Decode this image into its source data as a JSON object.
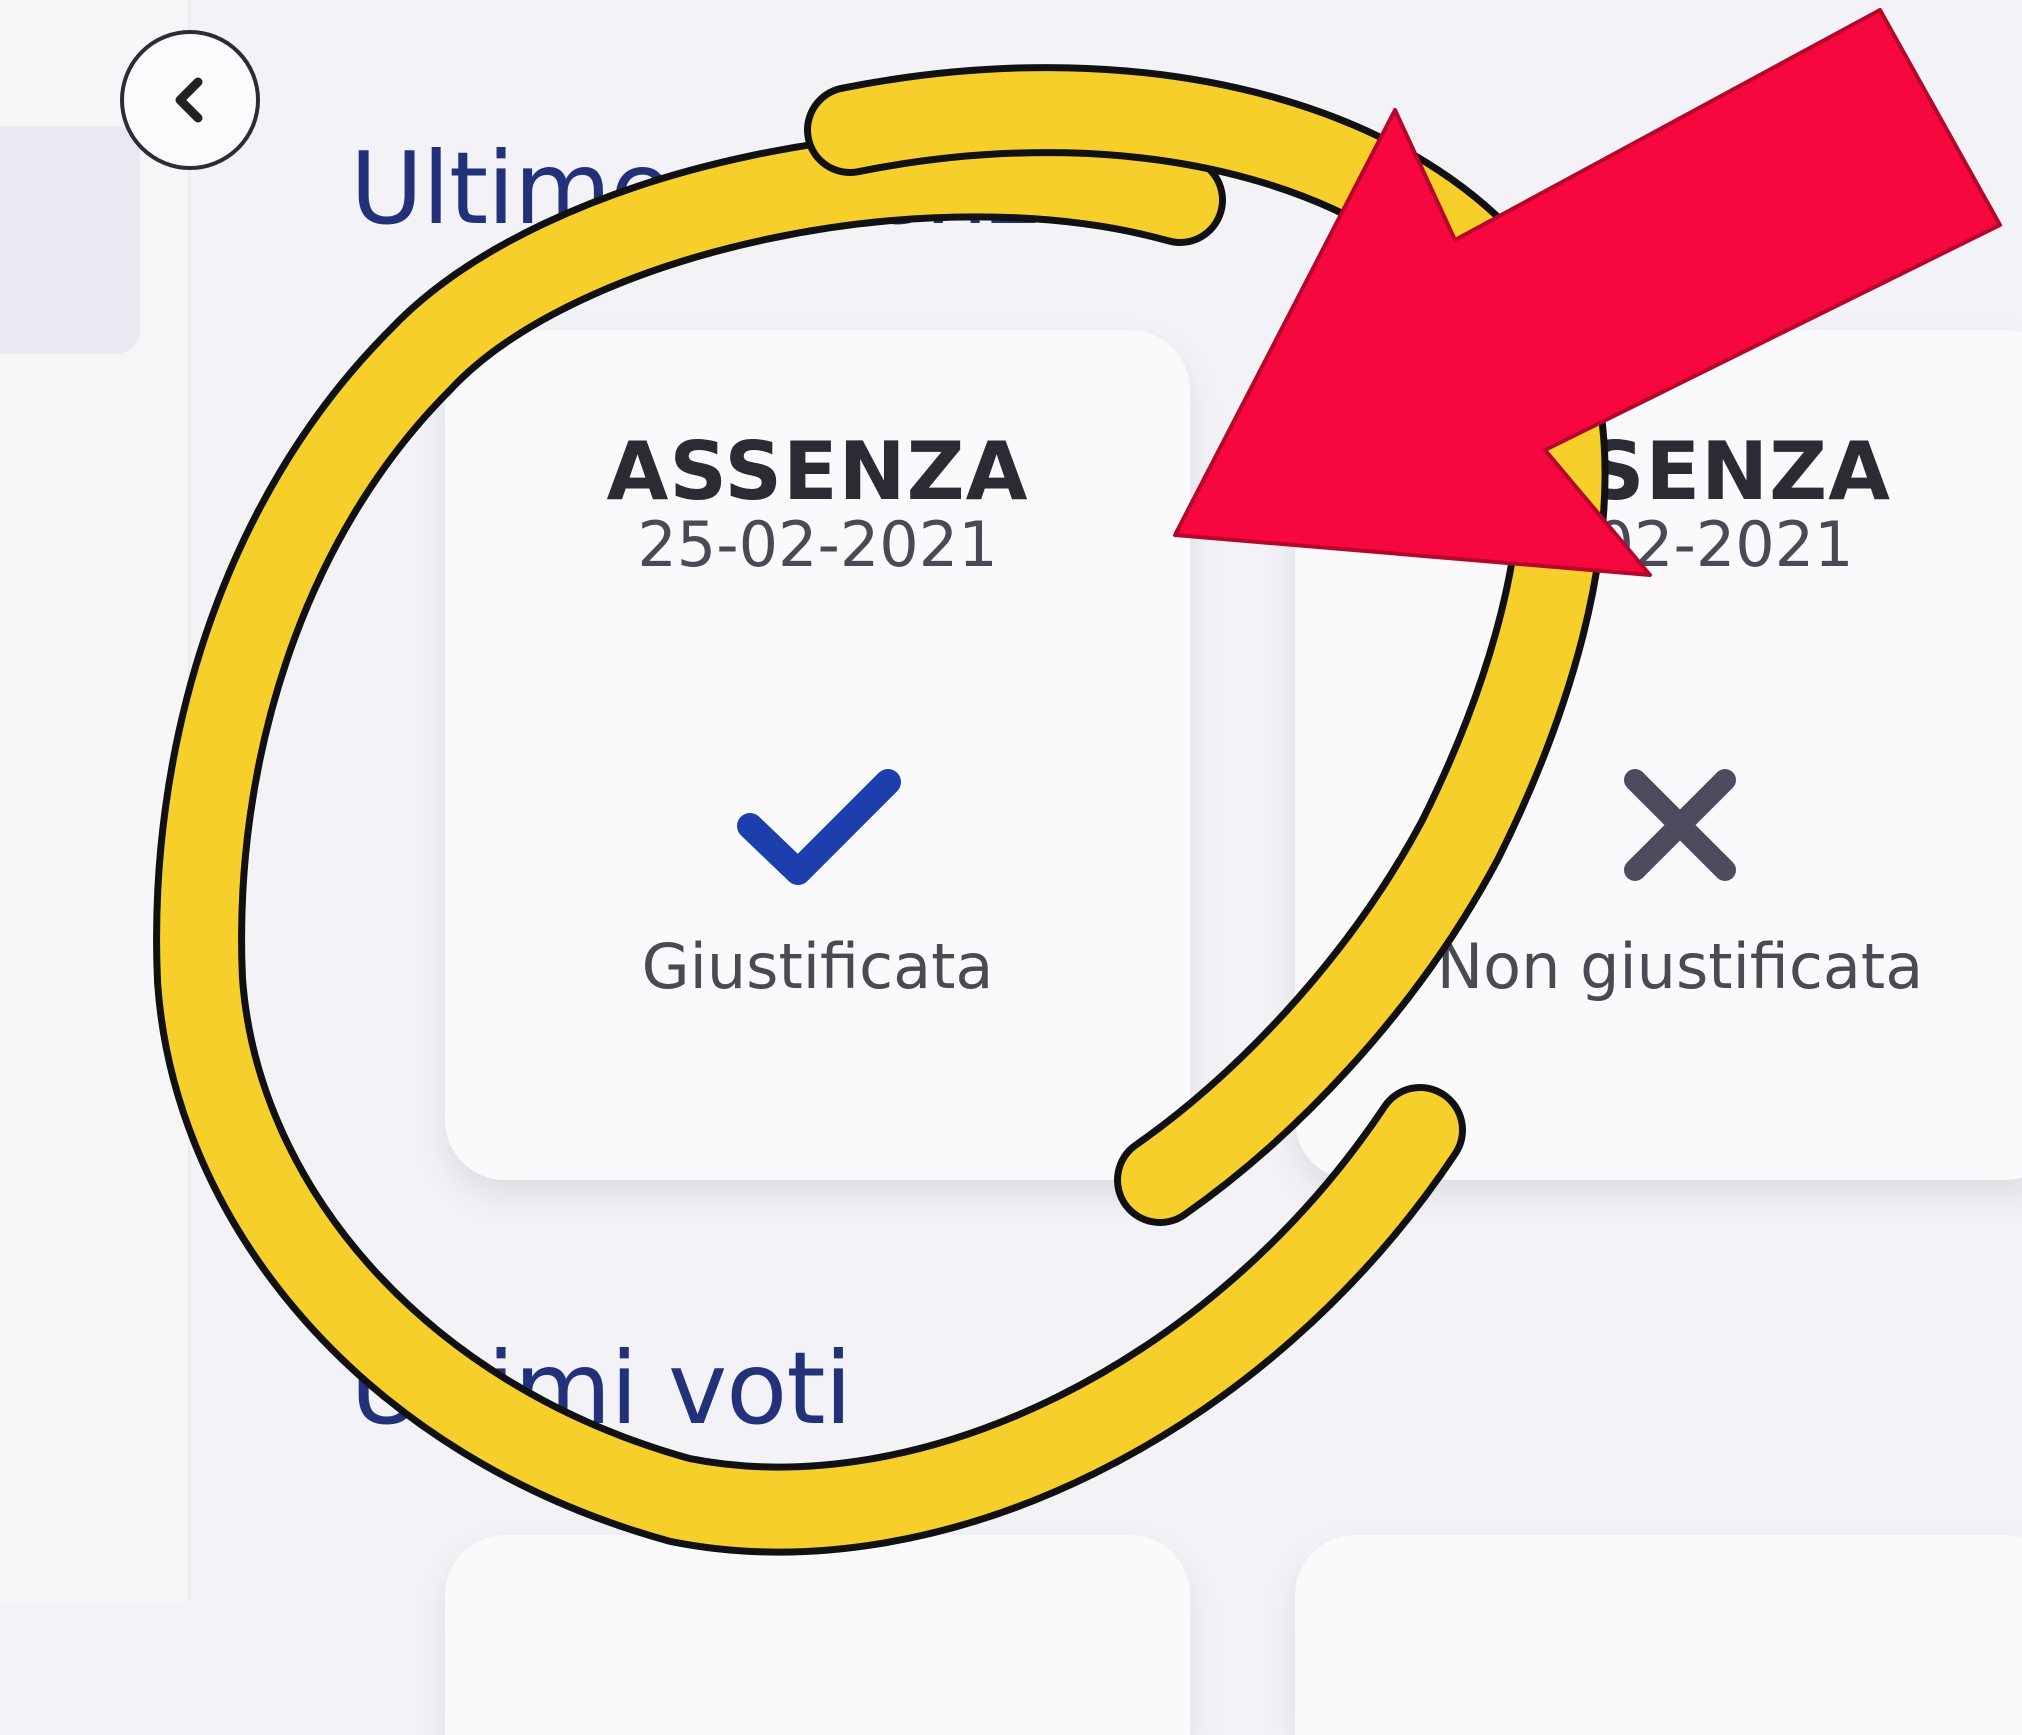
{
  "back_button": {
    "icon": "chevron-left-icon"
  },
  "absences_section": {
    "title": "Ultime assenze"
  },
  "absences": [
    {
      "type": "ASSENZA",
      "date": "25-02-2021",
      "status": "Giustificata",
      "icon": "check-icon",
      "icon_color": "#1c3fad"
    },
    {
      "type": "ASSENZA",
      "date": "??-02-2021",
      "status": "Non giustificata",
      "icon": "close-icon",
      "icon_color": "#4c4c5e"
    }
  ],
  "grades_section": {
    "title": "Ultimi voti"
  },
  "annotations": {
    "circle_color": "#f7cf2a",
    "arrow_color": "#f6083e"
  }
}
